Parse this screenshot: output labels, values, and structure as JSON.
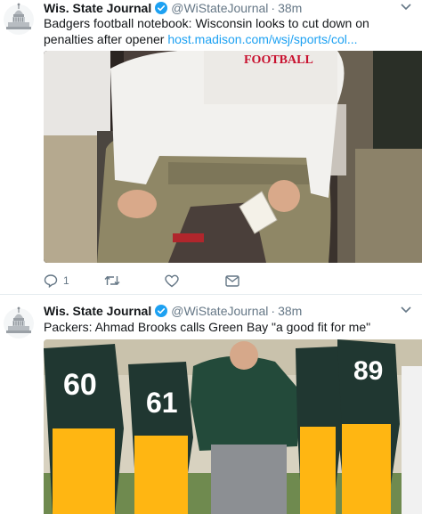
{
  "tweets": [
    {
      "author_name": "Wis. State Journal",
      "author_handle": "@WiStateJournal",
      "separator": "·",
      "time": "38m",
      "text": "Badgers football notebook: Wisconsin looks to cut down on penalties after opener ",
      "link": "host.madison.com/wsj/sports/col...",
      "photo_jersey_text": "FOOTBALL",
      "reply_count": "1"
    },
    {
      "author_name": "Wis. State Journal",
      "author_handle": "@WiStateJournal",
      "separator": "·",
      "time": "38m",
      "text": "Packers: Ahmad Brooks calls Green Bay \"a good fit for me\"",
      "photo_numbers": [
        "60",
        "61",
        "89"
      ]
    }
  ],
  "icons": {
    "avatar": "capitol-dome-icon",
    "verified": "verified-badge-icon",
    "caret": "chevron-down-icon",
    "reply": "reply-icon",
    "retweet": "retweet-icon",
    "like": "heart-icon",
    "message": "direct-message-icon"
  },
  "colors": {
    "link": "#1da1f2",
    "verified": "#1da1f2",
    "muted": "#657786",
    "text": "#14171a",
    "packers_green": "#203731",
    "packers_gold": "#ffb612"
  }
}
